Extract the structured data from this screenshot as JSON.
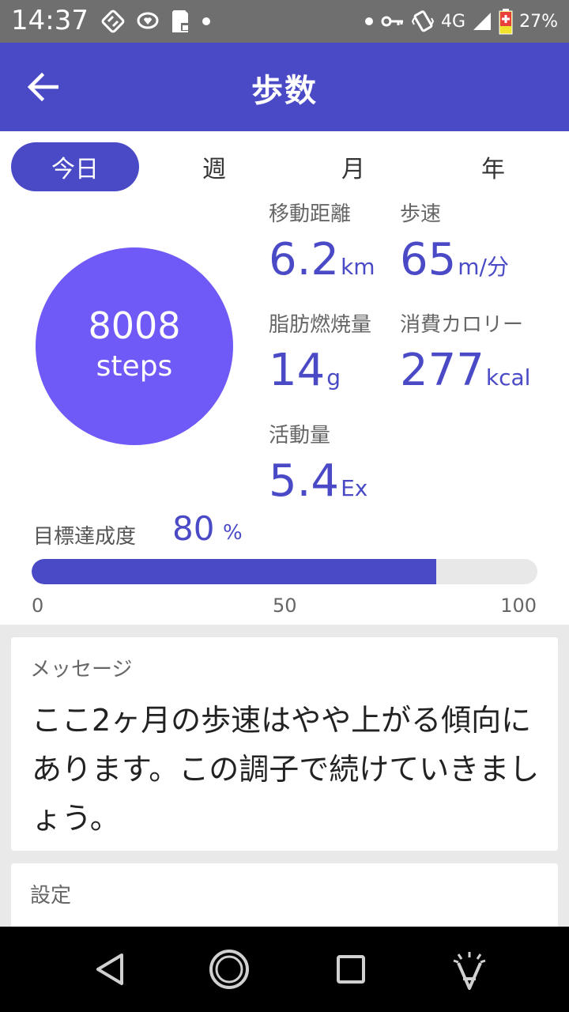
{
  "status_bar": {
    "time": "14:37",
    "network": "4G",
    "battery": "27%",
    "icons_left": [
      "sync-icon",
      "heart-chat-icon",
      "sd-card-icon",
      "dot-icon"
    ],
    "icons_right": [
      "dot-icon",
      "key-icon",
      "vibrate-icon",
      "signal-icon",
      "battery-icon"
    ]
  },
  "app_bar": {
    "title": "歩数",
    "back_icon": "arrow-left-icon"
  },
  "tabs": [
    {
      "label": "今日",
      "active": true
    },
    {
      "label": "週",
      "active": false
    },
    {
      "label": "月",
      "active": false
    },
    {
      "label": "年",
      "active": false
    }
  ],
  "steps": {
    "count": "8008",
    "unit": "steps"
  },
  "stats": {
    "distance": {
      "label": "移動距離",
      "value": "6.2",
      "unit": "km"
    },
    "pace": {
      "label": "歩速",
      "value": "65",
      "unit": "m/分"
    },
    "fat": {
      "label": "脂肪燃焼量",
      "value": "14",
      "unit": "g"
    },
    "calories": {
      "label": "消費カロリー",
      "value": "277",
      "unit": "kcal"
    },
    "activity": {
      "label": "活動量",
      "value": "5.4",
      "unit": "Ex"
    }
  },
  "goal": {
    "label": "目標達成度",
    "value": "80",
    "unit": "%",
    "progress_percent": 80,
    "scale": [
      "0",
      "50",
      "100"
    ]
  },
  "message": {
    "title": "メッセージ",
    "body": "ここ2ヶ月の歩速はやや上がる傾向にあります。この調子で続けていきましょう。"
  },
  "settings": {
    "title": "設定"
  },
  "nav_bar": {
    "icons": [
      "back-triangle-icon",
      "home-circle-icon",
      "recents-square-icon",
      "accessibility-icon"
    ]
  },
  "colors": {
    "primary": "#4a4ac7",
    "circle": "#705af7",
    "status_bar": "#6f6f6f",
    "track": "#e8e8e8",
    "background_gray": "#e9e9e9"
  }
}
